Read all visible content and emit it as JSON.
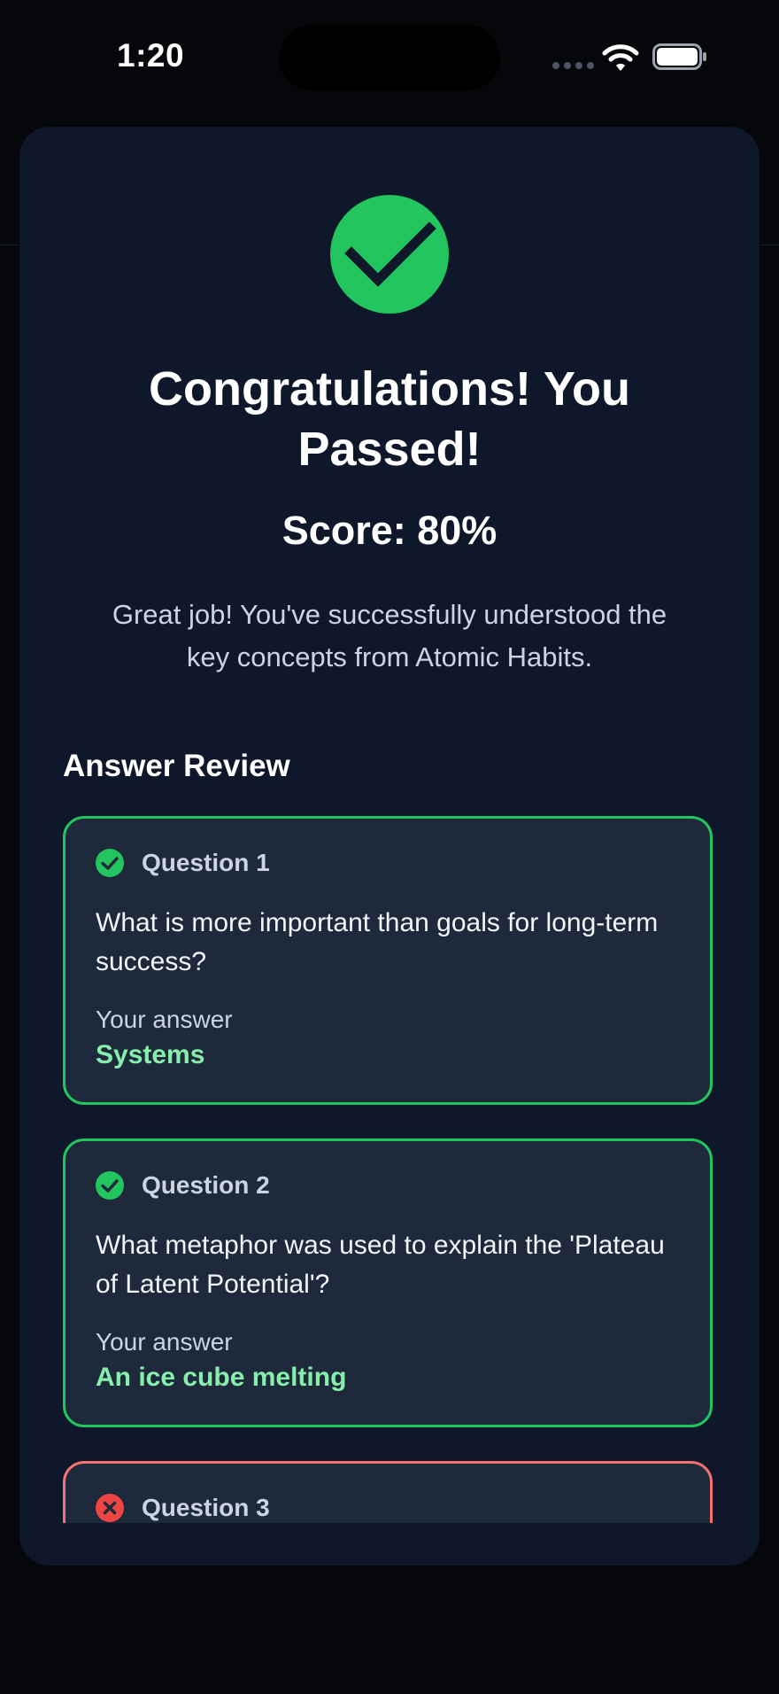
{
  "status_bar": {
    "time": "1:20"
  },
  "result": {
    "title": "Congratulations! You Passed!",
    "score": "Score: 80%",
    "message": "Great job! You've successfully understood the key concepts from Atomic Habits."
  },
  "review": {
    "heading": "Answer Review",
    "answer_label": "Your answer",
    "questions": [
      {
        "number": "Question 1",
        "text": "What is more important than goals for long-term success?",
        "answer": "Systems",
        "status": "correct"
      },
      {
        "number": "Question 2",
        "text": "What metaphor was used to explain the 'Plateau of Latent Potential'?",
        "answer": "An ice cube melting",
        "status": "correct"
      },
      {
        "number": "Question 3",
        "status": "incorrect"
      }
    ]
  },
  "colors": {
    "success": "#22c55e",
    "error": "#ef4444",
    "card_bg": "#0f172a",
    "item_bg": "#1e293b",
    "answer_text": "#86efac"
  },
  "icons": {
    "result": "check-circle-icon",
    "correct": "check-circle-icon",
    "incorrect": "x-circle-icon"
  }
}
